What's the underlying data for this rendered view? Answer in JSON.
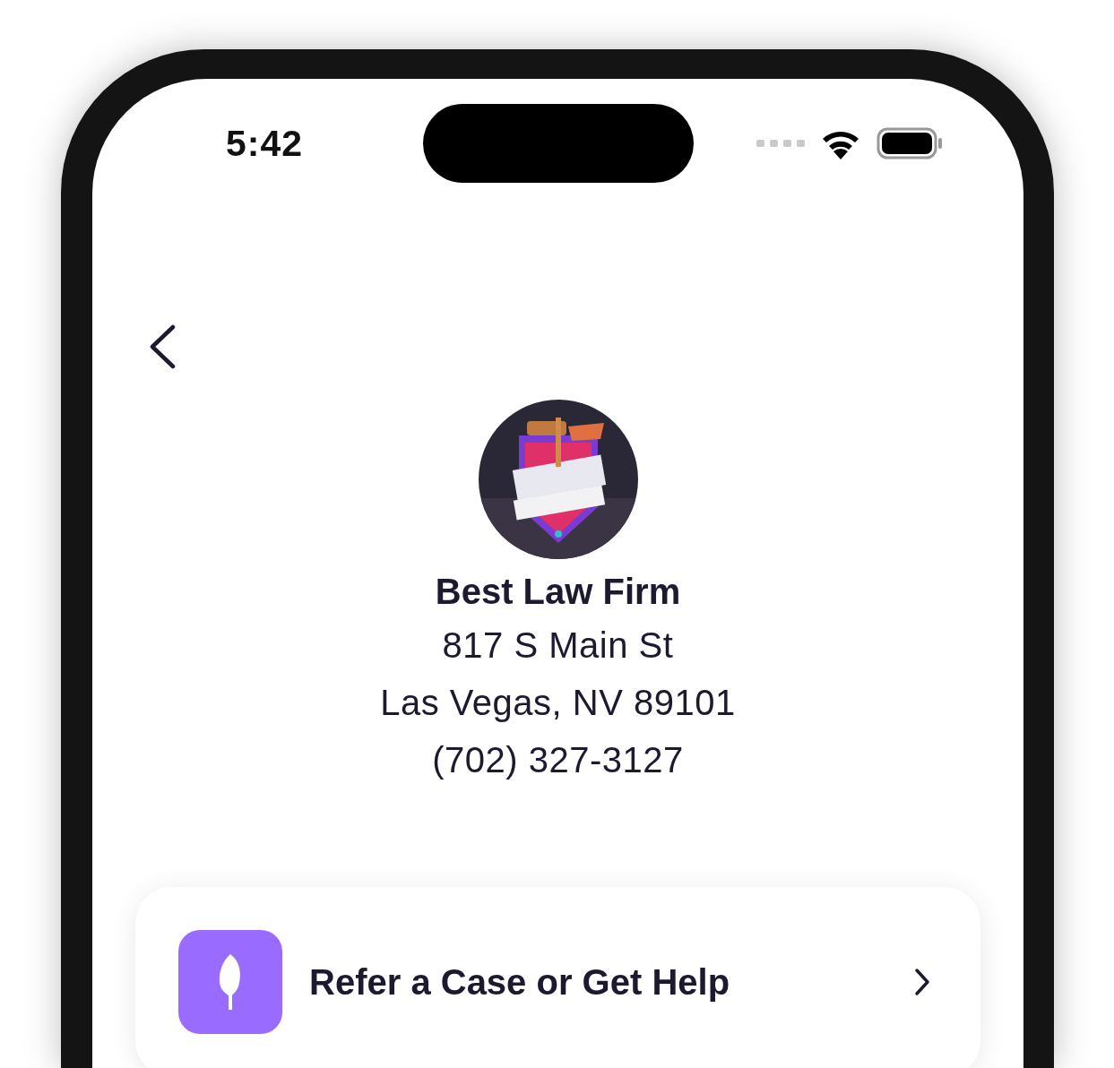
{
  "status_bar": {
    "time": "5:42"
  },
  "firm": {
    "name": "Best Law Firm",
    "address_lines": [
      "817 S Main St",
      "Las Vegas, NV 89101"
    ],
    "phone": "(702) 327-3127"
  },
  "actions": [
    {
      "label": "Refer a Case or Get Help"
    }
  ]
}
